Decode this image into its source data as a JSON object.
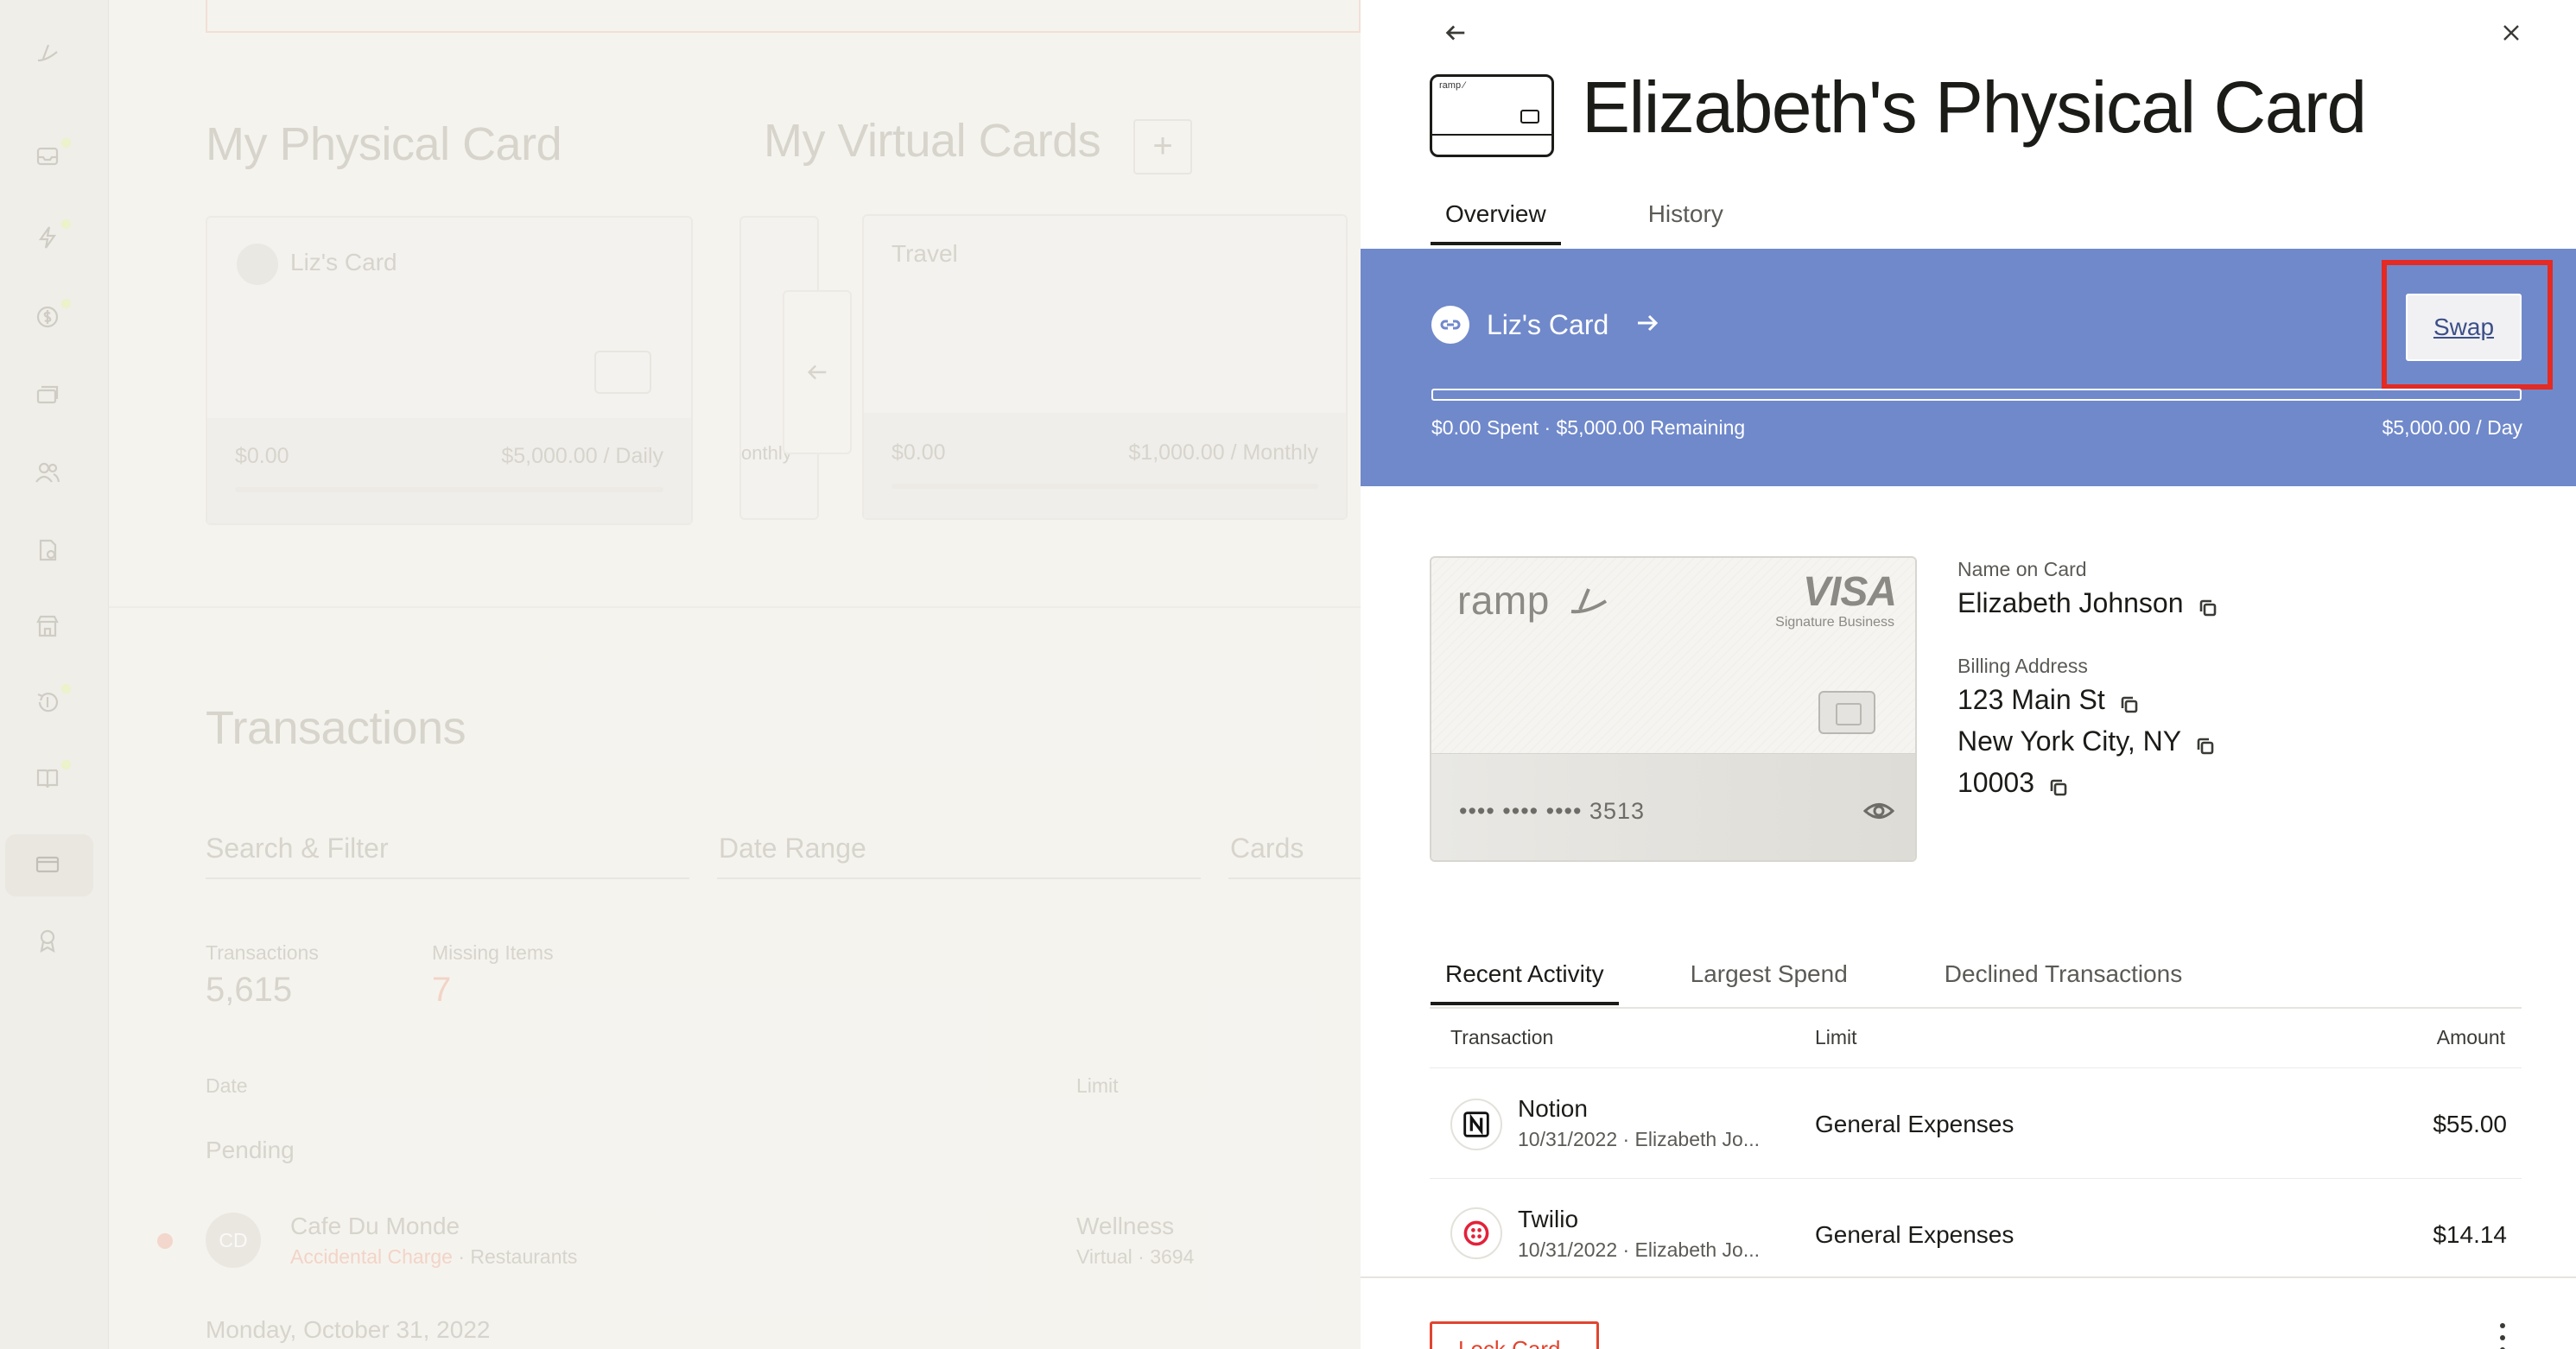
{
  "background": {
    "physical_heading": "My Physical Card",
    "virtual_heading": "My Virtual Cards",
    "add_virtual": "+",
    "physical_card": {
      "name": "Liz's Card",
      "spent": "$0.00",
      "limit": "$5,000.00 / Daily"
    },
    "partial_card": {
      "limit_fragment": "onthly"
    },
    "travel_card": {
      "name": "Travel",
      "spent": "$0.00",
      "limit": "$1,000.00 / Monthly"
    },
    "transactions_heading": "Transactions",
    "search_placeholder": "Search & Filter",
    "date_range_placeholder": "Date Range",
    "cards_placeholder": "Cards",
    "stats": {
      "transactions_label": "Transactions",
      "transactions_value": "5,615",
      "missing_label": "Missing Items",
      "missing_value": "7"
    },
    "columns": {
      "date": "Date",
      "limit": "Limit"
    },
    "pending_label": "Pending",
    "pending_row": {
      "initials": "CD",
      "merchant": "Cafe Du Monde",
      "status": "Accidental Charge",
      "category": " · Restaurants",
      "limit": "Wellness",
      "limit_sub": "Virtual · 3694"
    },
    "date_group": "Monday, October 31, 2022"
  },
  "drawer": {
    "title": "Elizabeth's Physical Card",
    "thumb_logo": "ramp ⁄",
    "tabs": [
      {
        "label": "Overview",
        "active": true
      },
      {
        "label": "History",
        "active": false
      }
    ],
    "banner": {
      "card_name": "Liz's Card",
      "swap_label": "Swap",
      "spent_text": "$0.00 Spent · $5,000.00 Remaining",
      "limit_text": "$5,000.00 / Day",
      "spent_fraction": 0.0,
      "color": "#7089cb",
      "highlight_color": "#e42a22"
    },
    "card": {
      "brand": "ramp",
      "network": "VISA",
      "network_sub": "Signature Business",
      "masked_number": "•••• •••• •••• 3513"
    },
    "details": {
      "name_label": "Name on Card",
      "name_value": "Elizabeth Johnson",
      "address_label": "Billing Address",
      "address_line1": "123 Main St",
      "address_line2": "New York City, NY",
      "address_line3": "10003"
    },
    "activity_tabs": [
      {
        "label": "Recent Activity",
        "active": true
      },
      {
        "label": "Largest Spend",
        "active": false
      },
      {
        "label": "Declined Transactions",
        "active": false
      }
    ],
    "table": {
      "headers": {
        "transaction": "Transaction",
        "limit": "Limit",
        "amount": "Amount"
      },
      "rows": [
        {
          "merchant": "Notion",
          "sub": "10/31/2022 · Elizabeth Jo...",
          "limit": "General Expenses",
          "amount": "$55.00",
          "logo": "notion-logo"
        },
        {
          "merchant": "Twilio",
          "sub": "10/31/2022 · Elizabeth Jo...",
          "limit": "General Expenses",
          "amount": "$14.14",
          "logo": "twilio-logo"
        }
      ]
    },
    "footer": {
      "lock_label": "Lock Card"
    }
  }
}
